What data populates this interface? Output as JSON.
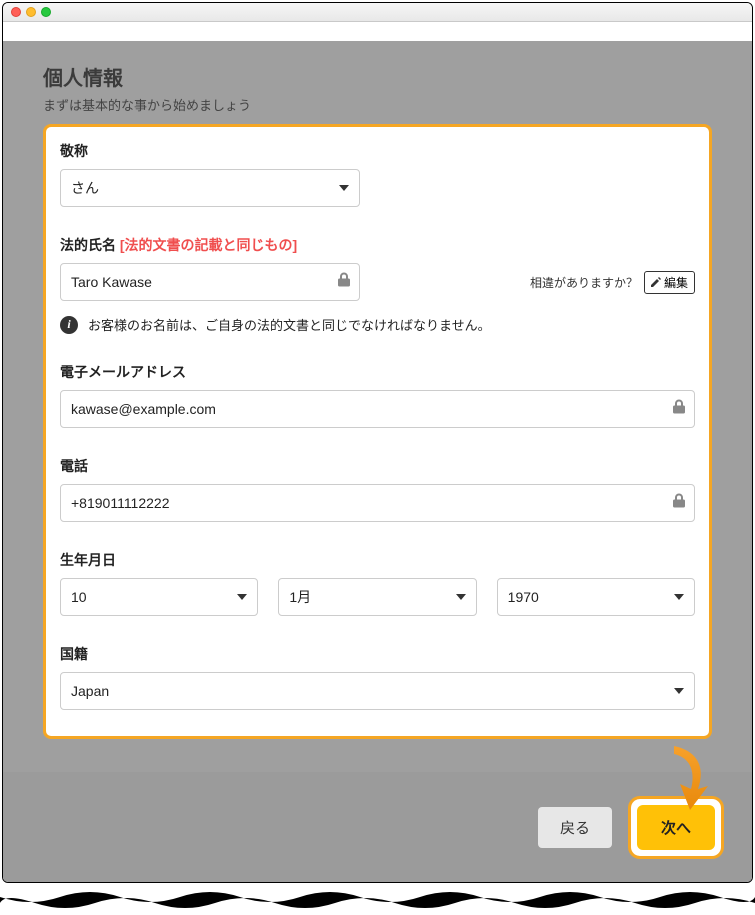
{
  "page": {
    "title": "個人情報",
    "subtitle": "まずは基本的な事から始めましょう"
  },
  "fields": {
    "honorific": {
      "label": "敬称",
      "value": "さん"
    },
    "legal_name": {
      "label": "法的氏名",
      "hint": "[法的文書の記載と同じもの]",
      "value": "Taro Kawase",
      "discrepancy_text": "相違がありますか？",
      "edit_label": "編集",
      "info_text": "お客様のお名前は、ご自身の法的文書と同じでなければなりません。"
    },
    "email": {
      "label": "電子メールアドレス",
      "value": "kawase@example.com"
    },
    "phone": {
      "label": "電話",
      "value": "+819011112222"
    },
    "dob": {
      "label": "生年月日",
      "day": "10",
      "month": "1月",
      "year": "1970"
    },
    "citizenship": {
      "label": "国籍",
      "value": "Japan"
    }
  },
  "footer": {
    "back": "戻る",
    "next": "次へ"
  }
}
